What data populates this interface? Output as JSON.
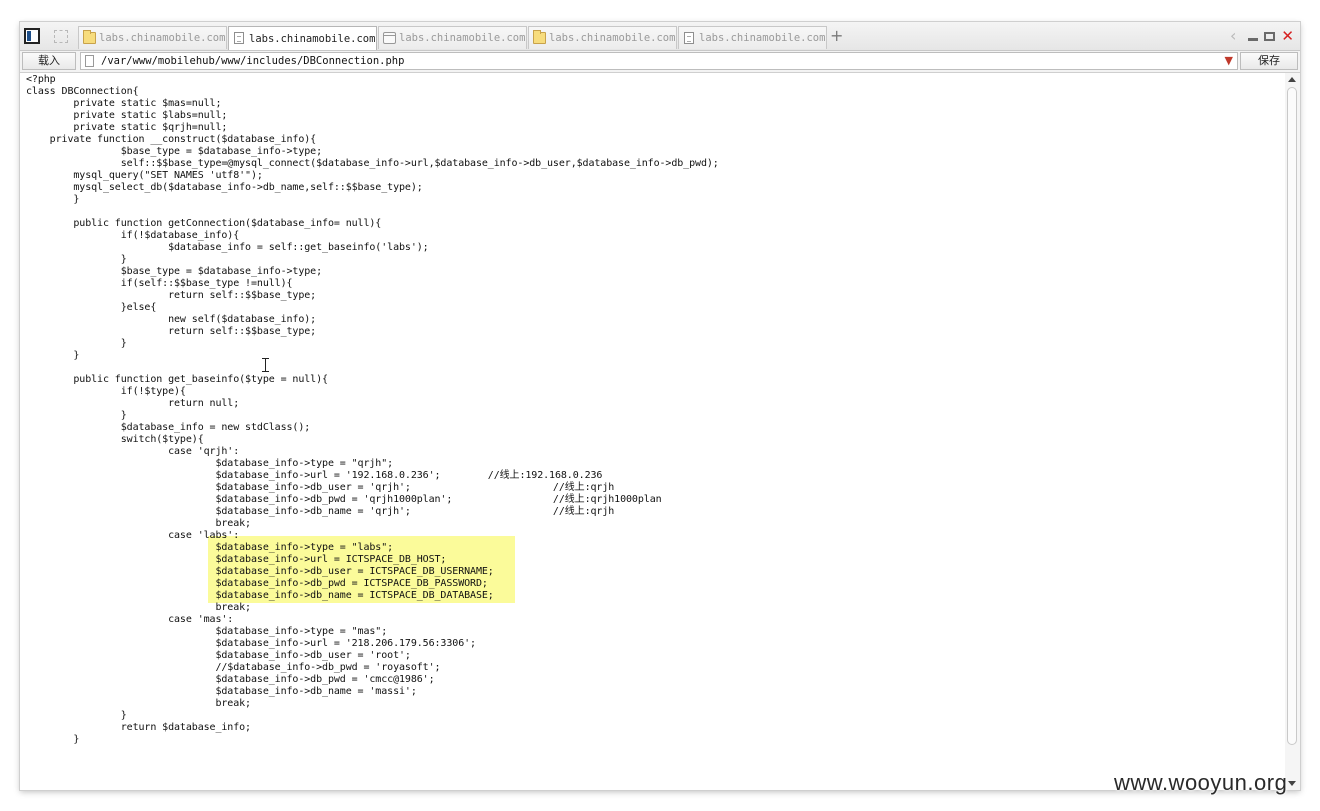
{
  "tabs": [
    {
      "label": "labs.chinamobile.com",
      "icon": "folder-icon",
      "active": false
    },
    {
      "label": "labs.chinamobile.com",
      "icon": "document-icon",
      "active": true
    },
    {
      "label": "labs.chinamobile.com",
      "icon": "page-icon",
      "active": false
    },
    {
      "label": "labs.chinamobile.com",
      "icon": "folder-icon",
      "active": false
    },
    {
      "label": "labs.chinamobile.com",
      "icon": "document-icon",
      "active": false
    }
  ],
  "new_tab_label": "+",
  "window_controls": {
    "back": "‹",
    "close": "✕"
  },
  "toolbar": {
    "load_label": "载入",
    "path": "/var/www/mobilehub/www/includes/DBConnection.php",
    "save_label": "保存"
  },
  "code_lines": [
    "<?php",
    "class DBConnection{",
    "        private static $mas=null;",
    "        private static $labs=null;",
    "        private static $qrjh=null;",
    "    private function __construct($database_info){",
    "                $base_type = $database_info->type;",
    "                self::$$base_type=@mysql_connect($database_info->url,$database_info->db_user,$database_info->db_pwd);",
    "        mysql_query(\"SET NAMES 'utf8'\");",
    "        mysql_select_db($database_info->db_name,self::$$base_type);",
    "        }",
    "",
    "        public function getConnection($database_info= null){",
    "                if(!$database_info){",
    "                        $database_info = self::get_baseinfo('labs');",
    "                }",
    "                $base_type = $database_info->type;",
    "                if(self::$$base_type !=null){",
    "                        return self::$$base_type;",
    "                }else{",
    "                        new self($database_info);",
    "                        return self::$$base_type;",
    "                }",
    "        }",
    "",
    "        public function get_baseinfo($type = null){",
    "                if(!$type){",
    "                        return null;",
    "                }",
    "                $database_info = new stdClass();",
    "                switch($type){",
    "                        case 'qrjh':",
    "                                $database_info->type = \"qrjh\";",
    "                                $database_info->url = '192.168.0.236';        //线上:192.168.0.236",
    "                                $database_info->db_user = 'qrjh';                        //线上:qrjh",
    "                                $database_info->db_pwd = 'qrjh1000plan';                 //线上:qrjh1000plan",
    "                                $database_info->db_name = 'qrjh';                        //线上:qrjh",
    "                                break;",
    "                        case 'labs':",
    "                                $database_info->type = \"labs\";",
    "                                $database_info->url = ICTSPACE_DB_HOST;",
    "                                $database_info->db_user = ICTSPACE_DB_USERNAME;",
    "                                $database_info->db_pwd = ICTSPACE_DB_PASSWORD;",
    "                                $database_info->db_name = ICTSPACE_DB_DATABASE;",
    "                                break;",
    "                        case 'mas':",
    "                                $database_info->type = \"mas\";",
    "                                $database_info->url = '218.206.179.56:3306';",
    "                                $database_info->db_user = 'root';",
    "                                //$database_info->db_pwd = 'royasoft';",
    "                                $database_info->db_pwd = 'cmcc@1986';",
    "                                $database_info->db_name = 'massi';",
    "                                break;",
    "                }",
    "                return $database_info;",
    "        }"
  ],
  "watermark": "www.wooyun.org",
  "colors": {
    "highlight": "#fbfb9a",
    "close": "#d62020"
  }
}
